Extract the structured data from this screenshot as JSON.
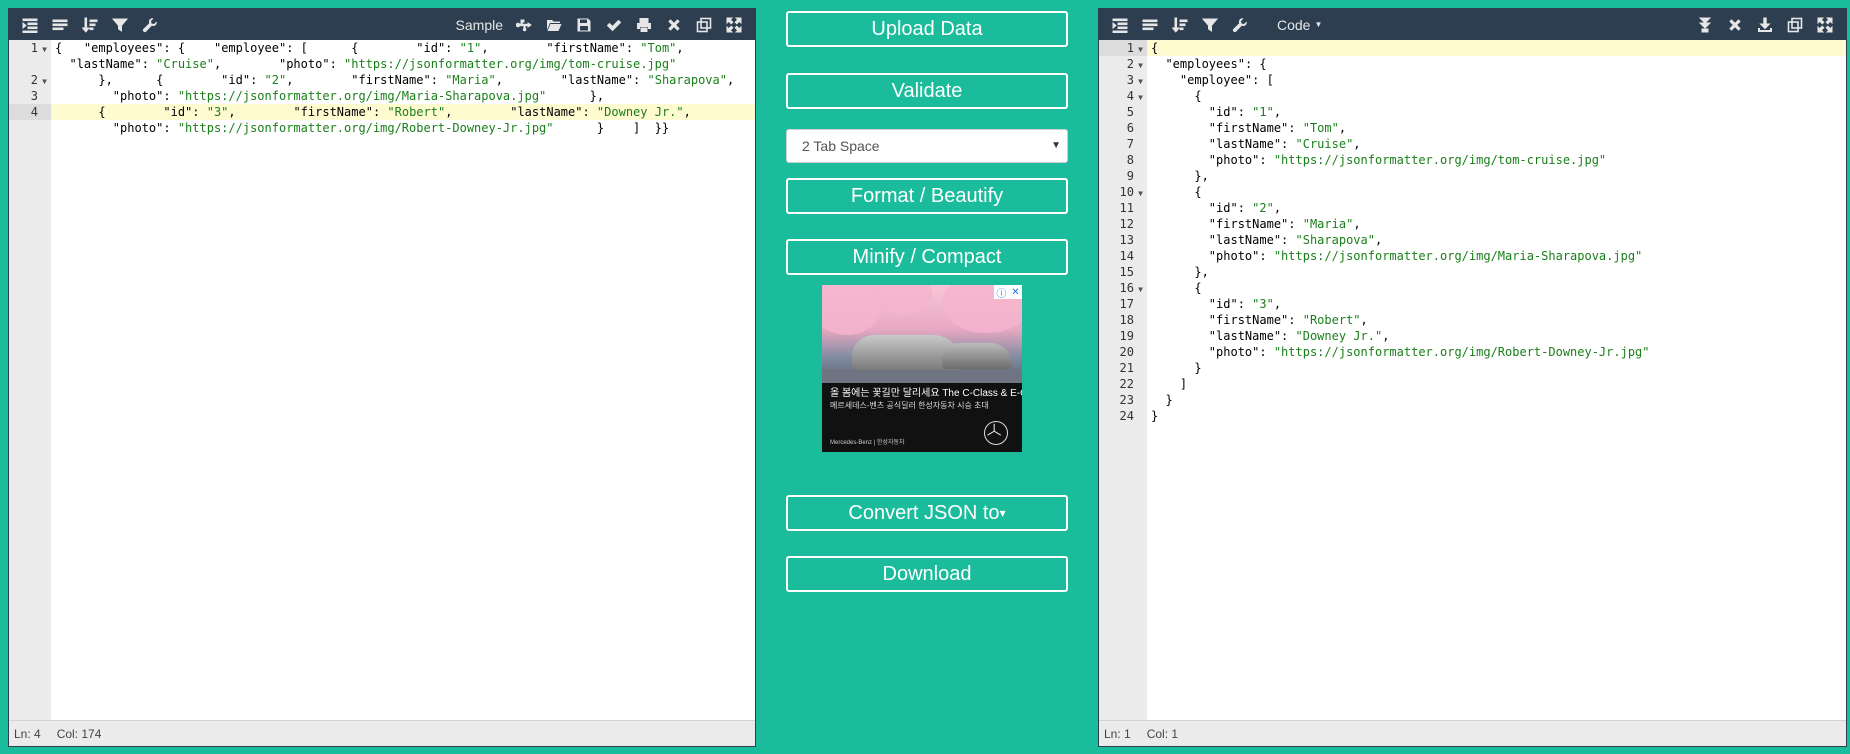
{
  "left_panel": {
    "toolbar": {
      "sample_label": "Sample"
    },
    "lines": [
      {
        "num": "1",
        "fold": true,
        "text": "{   \"employees\": {    \"employee\": [      {        \"id\": \"1\",        \"firstName\": \"Tom\","
      },
      {
        "num": "",
        "fold": false,
        "text": "  \"lastName\": \"Cruise\",        \"photo\": \"https://jsonformatter.org/img/tom-cruise.jpg\""
      },
      {
        "num": "2",
        "fold": true,
        "text": "      },      {        \"id\": \"2\",        \"firstName\": \"Maria\",        \"lastName\": \"Sharapova\","
      },
      {
        "num": "3",
        "fold": false,
        "text": "        \"photo\": \"https://jsonformatter.org/img/Maria-Sharapova.jpg\"      },"
      },
      {
        "num": "4",
        "fold": false,
        "text": "      {        \"id\": \"3\",        \"firstName\": \"Robert\",        \"lastName\": \"Downey Jr.\","
      },
      {
        "num": "",
        "fold": false,
        "text": "        \"photo\": \"https://jsonformatter.org/img/Robert-Downey-Jr.jpg\"      }    ]  }}"
      }
    ],
    "active_line_index": 4,
    "status": {
      "ln": "Ln: 4",
      "col": "Col: 174"
    }
  },
  "center": {
    "upload_label": "Upload Data",
    "validate_label": "Validate",
    "tab_select_value": "2 Tab Space",
    "format_label": "Format / Beautify",
    "minify_label": "Minify / Compact",
    "convert_label": "Convert JSON to",
    "download_label": "Download",
    "ad": {
      "text1": "올 봄에는 꽃길만 달리세요 The C-Class & E-Class",
      "text2": "메르세데스-벤츠 공식딜러 한성자동차 시승 초대",
      "brand": "Mercedes-Benz | 한성자동차"
    }
  },
  "right_panel": {
    "toolbar": {
      "code_label": "Code"
    },
    "lines": [
      {
        "num": "1",
        "fold": true,
        "text": "{"
      },
      {
        "num": "2",
        "fold": true,
        "text": "  \"employees\": {"
      },
      {
        "num": "3",
        "fold": true,
        "text": "    \"employee\": ["
      },
      {
        "num": "4",
        "fold": true,
        "text": "      {"
      },
      {
        "num": "5",
        "fold": false,
        "text": "        \"id\": \"1\","
      },
      {
        "num": "6",
        "fold": false,
        "text": "        \"firstName\": \"Tom\","
      },
      {
        "num": "7",
        "fold": false,
        "text": "        \"lastName\": \"Cruise\","
      },
      {
        "num": "8",
        "fold": false,
        "text": "        \"photo\": \"https://jsonformatter.org/img/tom-cruise.jpg\""
      },
      {
        "num": "9",
        "fold": false,
        "text": "      },"
      },
      {
        "num": "10",
        "fold": true,
        "text": "      {"
      },
      {
        "num": "11",
        "fold": false,
        "text": "        \"id\": \"2\","
      },
      {
        "num": "12",
        "fold": false,
        "text": "        \"firstName\": \"Maria\","
      },
      {
        "num": "13",
        "fold": false,
        "text": "        \"lastName\": \"Sharapova\","
      },
      {
        "num": "14",
        "fold": false,
        "text": "        \"photo\": \"https://jsonformatter.org/img/Maria-Sharapova.jpg\""
      },
      {
        "num": "15",
        "fold": false,
        "text": "      },"
      },
      {
        "num": "16",
        "fold": true,
        "text": "      {"
      },
      {
        "num": "17",
        "fold": false,
        "text": "        \"id\": \"3\","
      },
      {
        "num": "18",
        "fold": false,
        "text": "        \"firstName\": \"Robert\","
      },
      {
        "num": "19",
        "fold": false,
        "text": "        \"lastName\": \"Downey Jr.\","
      },
      {
        "num": "20",
        "fold": false,
        "text": "        \"photo\": \"https://jsonformatter.org/img/Robert-Downey-Jr.jpg\""
      },
      {
        "num": "21",
        "fold": false,
        "text": "      }"
      },
      {
        "num": "22",
        "fold": false,
        "text": "    ]"
      },
      {
        "num": "23",
        "fold": false,
        "text": "  }"
      },
      {
        "num": "24",
        "fold": false,
        "text": "}"
      }
    ],
    "active_line_index": 0,
    "status": {
      "ln": "Ln: 1",
      "col": "Col: 1"
    }
  },
  "colors": {
    "background": "#1abc9c",
    "toolbar": "#2c3e50",
    "string": "#1a7f1a",
    "active_line": "#fffbd1"
  }
}
